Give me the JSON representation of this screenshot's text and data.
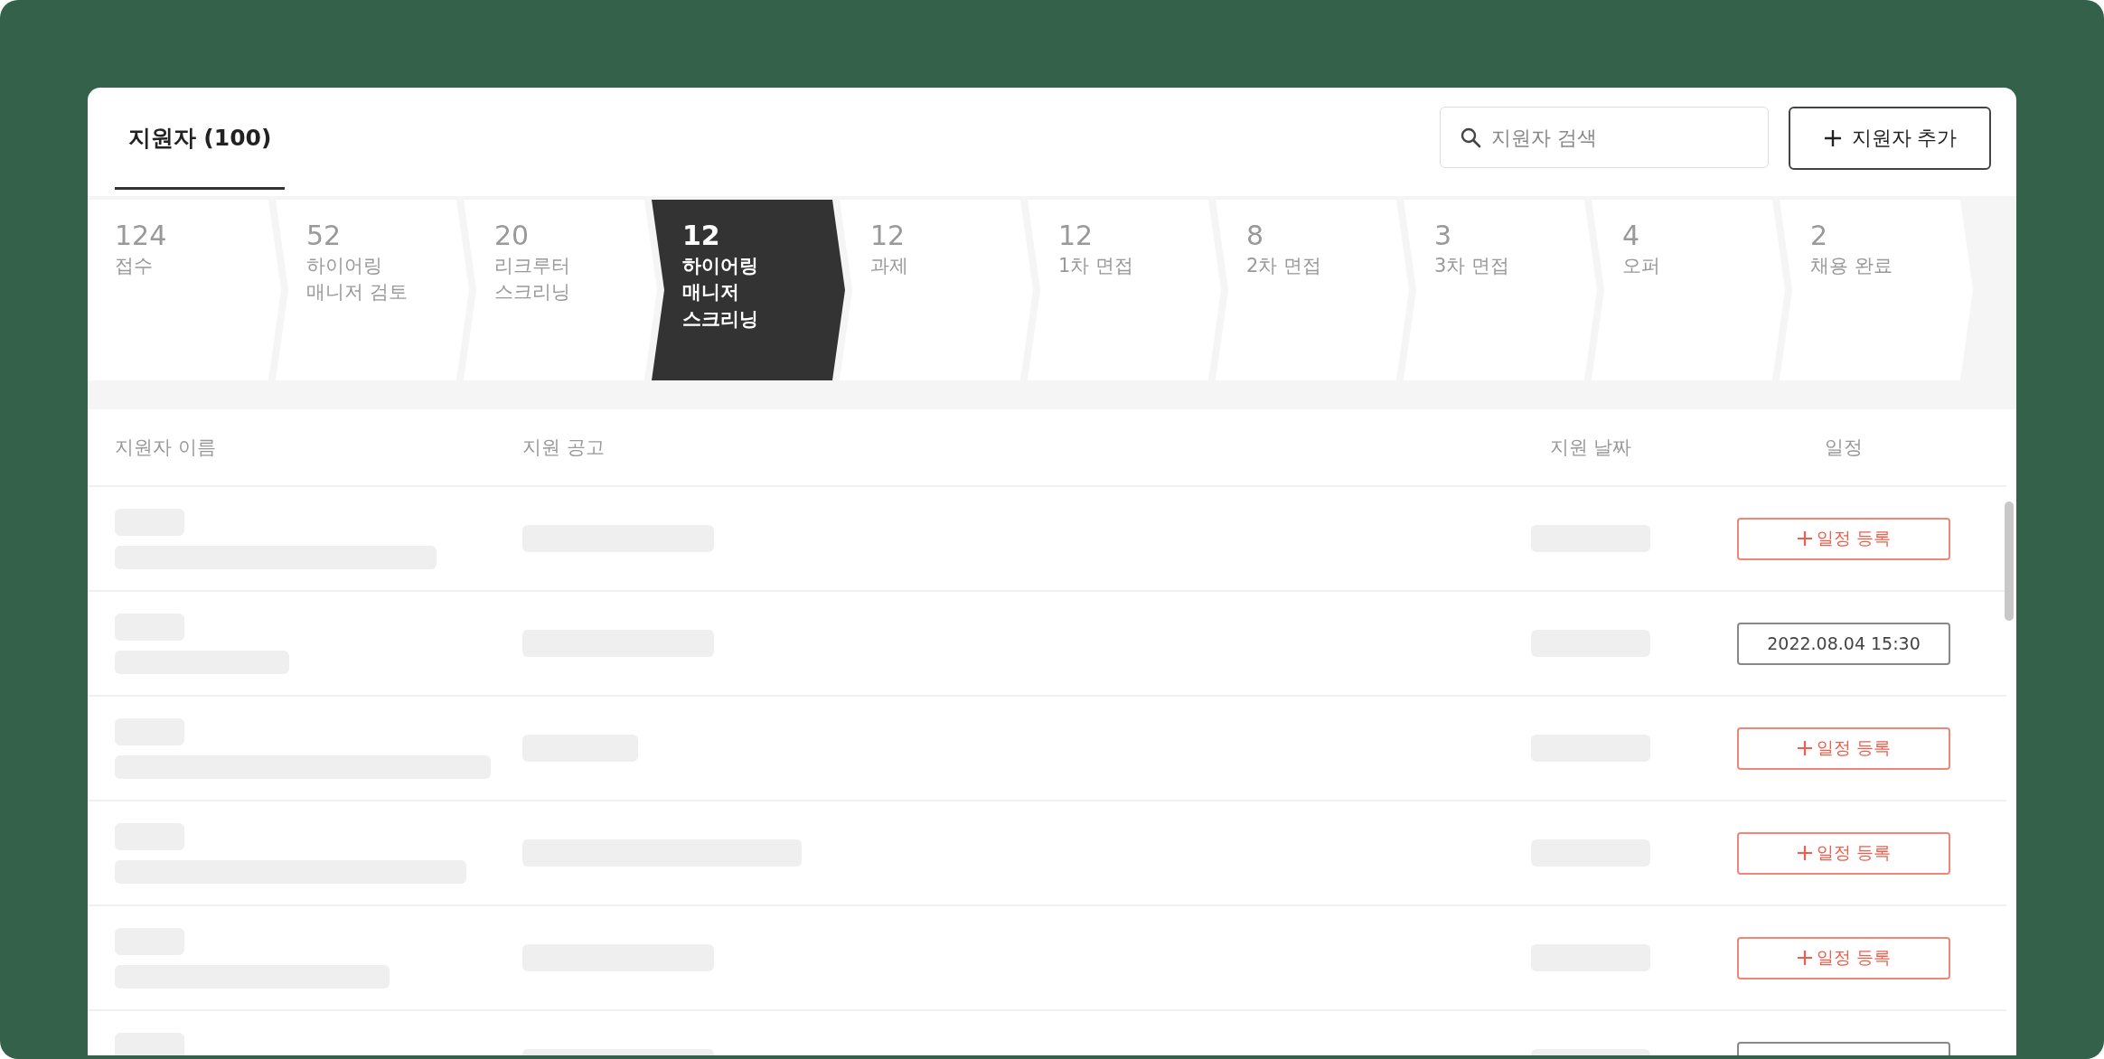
{
  "header": {
    "tab": {
      "label": "지원자 (100)",
      "selected": true
    },
    "search": {
      "placeholder": "지원자 검색"
    },
    "add_button": {
      "label": "지원자 추가"
    }
  },
  "stages": [
    {
      "count": "124",
      "label": "접수",
      "selected": false
    },
    {
      "count": "52",
      "label": "하이어링 매니저 검토",
      "selected": false
    },
    {
      "count": "20",
      "label": "리크루터 스크리닝",
      "selected": false
    },
    {
      "count": "12",
      "label": "하이어링 매니저 스크리닝",
      "selected": true
    },
    {
      "count": "12",
      "label": "과제",
      "selected": false
    },
    {
      "count": "12",
      "label": "1차 면접",
      "selected": false
    },
    {
      "count": "8",
      "label": "2차 면접",
      "selected": false
    },
    {
      "count": "3",
      "label": "3차 면접",
      "selected": false
    },
    {
      "count": "4",
      "label": "오퍼",
      "selected": false
    },
    {
      "count": "2",
      "label": "채용 완료",
      "selected": false
    }
  ],
  "table": {
    "columns": [
      "지원자 이름",
      "지원 공고",
      "지원 날짜",
      "일정"
    ],
    "rows": [
      {
        "schedule": {
          "kind": "add",
          "label": "일정 등록"
        }
      },
      {
        "schedule": {
          "kind": "date",
          "label": "2022.08.04 15:30"
        }
      },
      {
        "schedule": {
          "kind": "add",
          "label": "일정 등록"
        }
      },
      {
        "schedule": {
          "kind": "add",
          "label": "일정 등록"
        }
      },
      {
        "schedule": {
          "kind": "add",
          "label": "일정 등록"
        }
      },
      {
        "schedule": {
          "kind": "date"
        }
      }
    ]
  }
}
